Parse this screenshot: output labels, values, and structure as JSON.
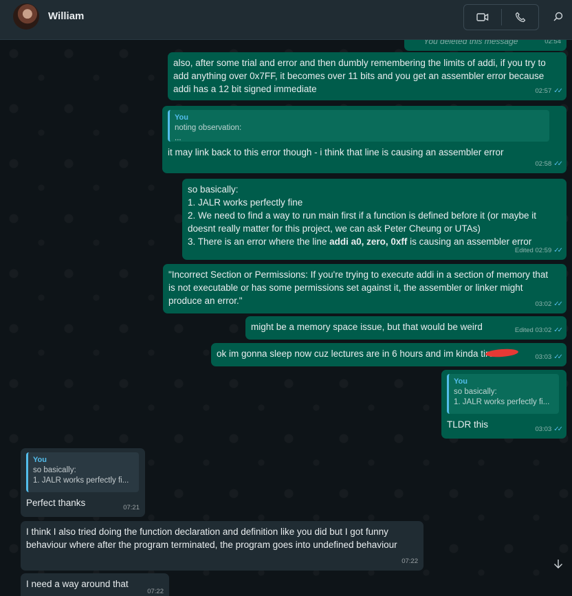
{
  "header": {
    "contact_name": "William",
    "icons": {
      "video": "video-camera-icon",
      "call": "phone-icon",
      "search": "search-icon"
    }
  },
  "messages": {
    "deleted": {
      "text": "You deleted this message",
      "time": "02:54"
    },
    "m1": {
      "text": "also, after some trial and error and then dumbly remembering the limits of addi, if you try to add anything over 0x7FF, it becomes over 11 bits and you get an assembler error because addi has a 12 bit signed immediate",
      "time": "02:57"
    },
    "m2": {
      "quote_author": "You",
      "quote_line1": "noting observation:",
      "quote_line2": "...",
      "text": "it may link back to this error though - i think that line is causing an assembler error",
      "time": "02:58"
    },
    "m3": {
      "line0": "so basically:",
      "line1": "1. JALR works perfectly fine",
      "line2": "2. We need to find a way to run main first if a function is defined before it (or maybe it doesnt really matter for this project, we can ask Peter Cheung or UTAs)",
      "line3_pre": "3. There is an error where the line ",
      "line3_bold": "addi a0, zero, 0xff",
      "line3_post": " is causing an assembler error",
      "time": "Edited 02:59"
    },
    "m4": {
      "text": "\"Incorrect Section or Permissions: If you're trying to execute addi in a section of memory that is not executable or has some permissions set against it, the assembler or linker might produce an error.\"",
      "time": "03:02"
    },
    "m5": {
      "text": "might be a memory space issue, but that would be weird",
      "time": "Edited 03:02"
    },
    "m6": {
      "text": "ok im gonna sleep now cuz lectures are in 6 hours and im kinda tired",
      "time": "03:03"
    },
    "m7": {
      "quote_author": "You",
      "quote_line1": "so basically:",
      "quote_line2": "1. JALR works perfectly fi...",
      "text": "TLDR this",
      "time": "03:03"
    },
    "r1": {
      "quote_author": "You",
      "quote_line1": "so basically:",
      "quote_line2": "1. JALR works perfectly fi...",
      "text": "Perfect thanks",
      "time": "07:21"
    },
    "r2": {
      "text": "I think I also tried doing the function declaration and definition like you did but I got funny behaviour where after the program terminated, the program goes into undefined behaviour",
      "time": "07:22"
    },
    "r3": {
      "text": "I need a way around that",
      "time": "07:22"
    }
  },
  "colors": {
    "outgoing": "#005c4b",
    "incoming": "#202c33",
    "tick": "#53bdeb",
    "background": "#0b141a"
  }
}
